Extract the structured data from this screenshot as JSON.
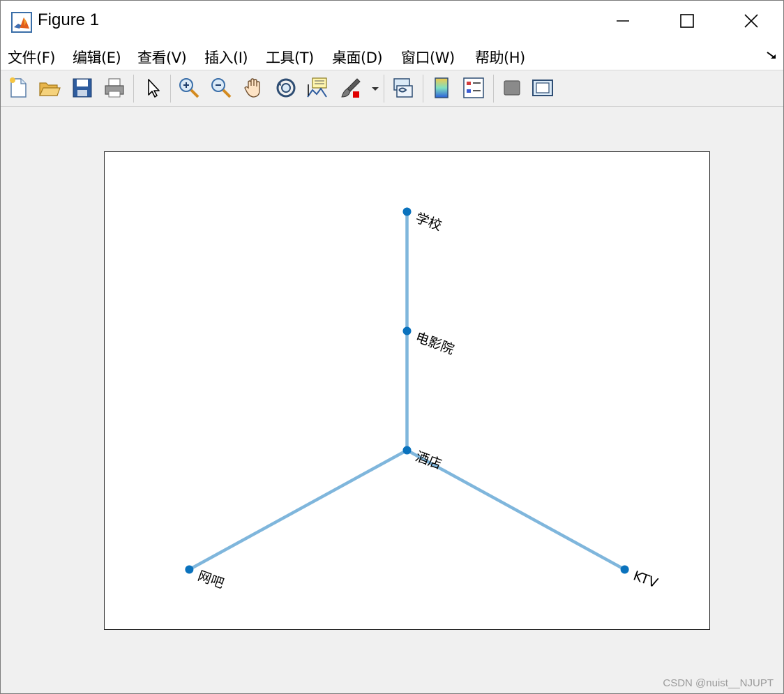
{
  "window": {
    "title": "Figure 1",
    "minimize_label": "—",
    "maximize_label": "☐",
    "close_label": "✕"
  },
  "menu": {
    "items": [
      "文件(F)",
      "编辑(E)",
      "查看(V)",
      "插入(I)",
      "工具(T)",
      "桌面(D)",
      "窗口(W)",
      "帮助(H)"
    ]
  },
  "toolbar": {
    "icons": [
      "new-figure-icon",
      "open-file-icon",
      "save-icon",
      "print-icon",
      "select-arrow-icon",
      "zoom-in-icon",
      "zoom-out-icon",
      "pan-hand-icon",
      "rotate-3d-icon",
      "data-cursor-icon",
      "brush-icon",
      "brush-dropdown-icon",
      "link-plot-icon",
      "colorbar-icon",
      "legend-icon",
      "hide-plot-tools-icon",
      "show-plot-tools-icon"
    ]
  },
  "colors": {
    "edge": "#7fb6dc",
    "node": "#0a72bd",
    "axes_border": "#262626",
    "background": "#f0f0f0"
  },
  "chart_data": {
    "type": "graph",
    "title": "",
    "nodes": [
      {
        "id": "学校",
        "label": "学校",
        "x": 0,
        "y": 3.0
      },
      {
        "id": "电影院",
        "label": "电影院",
        "x": 0,
        "y": 2.0
      },
      {
        "id": "酒店",
        "label": "酒店",
        "x": 0,
        "y": 1.0
      },
      {
        "id": "网吧",
        "label": "网吧",
        "x": -1.8,
        "y": 0.0
      },
      {
        "id": "KTV",
        "label": "KTV",
        "x": 1.8,
        "y": 0.0
      }
    ],
    "edges": [
      [
        "学校",
        "电影院"
      ],
      [
        "电影院",
        "酒店"
      ],
      [
        "酒店",
        "网吧"
      ],
      [
        "酒店",
        "KTV"
      ]
    ],
    "xlim": [
      -2.5,
      2.5
    ],
    "ylim": [
      -0.5,
      3.5
    ],
    "grid": false,
    "axis_visible": false
  },
  "watermark": "CSDN @nuist__NJUPT"
}
